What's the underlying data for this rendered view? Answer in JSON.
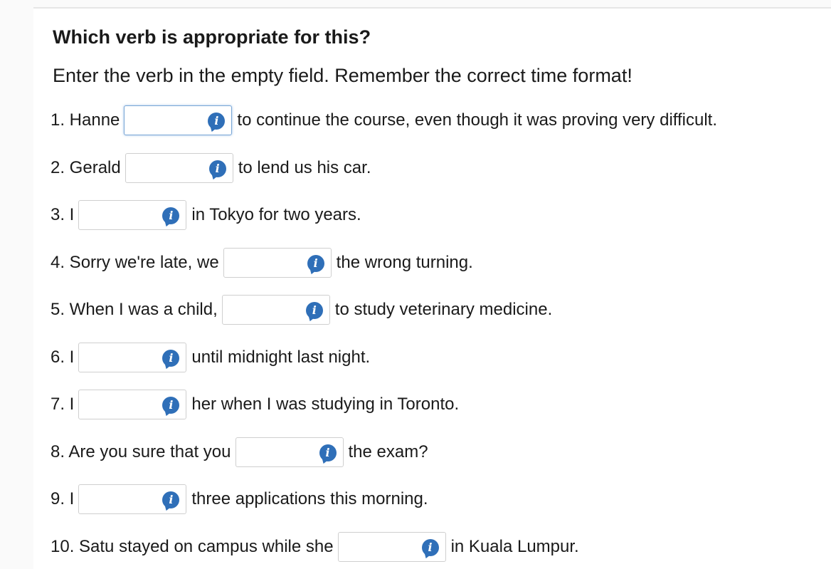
{
  "exercise": {
    "heading": "Which verb is appropriate for this?",
    "instruction": "Enter the verb in the empty field. Remember the correct time format!",
    "info_icon": "info-icon",
    "items": [
      {
        "before": "1. Hanne",
        "after": "to continue the course, even though it was proving very difficult.",
        "value": "",
        "focused": true
      },
      {
        "before": "2. Gerald",
        "after": "to lend us his car.",
        "value": ""
      },
      {
        "before": "3. I",
        "after": "in Tokyo for two years.",
        "value": ""
      },
      {
        "before": "4. Sorry we're late, we",
        "after": "the wrong turning.",
        "value": ""
      },
      {
        "before": "5. When I was a child,",
        "after": "to study veterinary medicine.",
        "value": ""
      },
      {
        "before": "6. I",
        "after": "until midnight last night.",
        "value": ""
      },
      {
        "before": "7. I",
        "after": "her when I was studying in Toronto.",
        "value": ""
      },
      {
        "before": "8. Are you sure that you",
        "after": "the exam?",
        "value": ""
      },
      {
        "before": "9. I",
        "after": "three applications this morning.",
        "value": ""
      },
      {
        "before": "10. Satu stayed on campus while she",
        "after": "in Kuala Lumpur.",
        "value": ""
      }
    ]
  }
}
